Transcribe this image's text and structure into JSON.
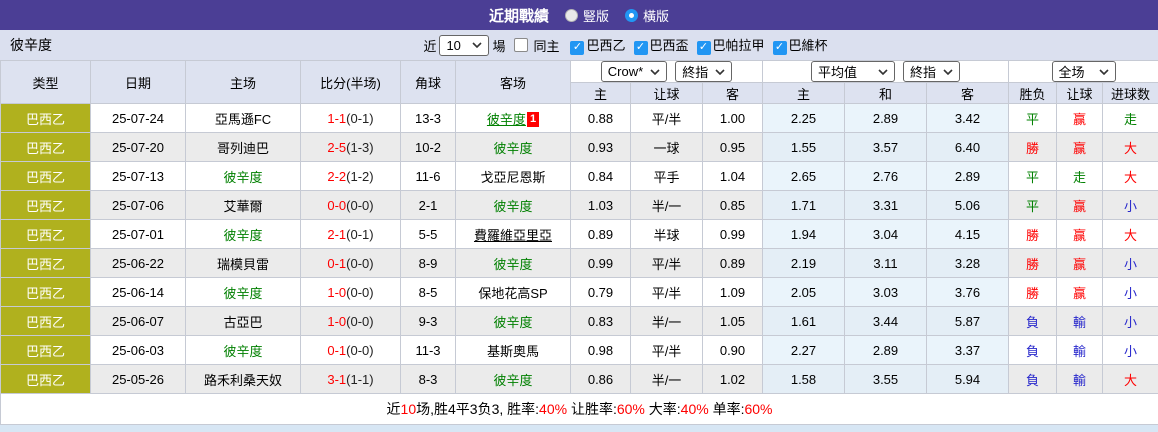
{
  "titlebar": {
    "title": "近期戰績",
    "radios": [
      {
        "label": "豎版",
        "checked": false
      },
      {
        "label": "橫版",
        "checked": true
      }
    ]
  },
  "filterbar": {
    "team": "彼辛度",
    "near_label": "近",
    "count_value": "10",
    "games_label": "場",
    "same_home": {
      "label": "同主",
      "checked": false
    },
    "leagues": [
      {
        "label": "巴西乙",
        "checked": true
      },
      {
        "label": "巴西盃",
        "checked": true
      },
      {
        "label": "巴帕拉甲",
        "checked": true
      },
      {
        "label": "巴維杯",
        "checked": true
      }
    ]
  },
  "colors": {
    "titlebar_purple": "#4b3e95",
    "league_cell_olive": "#b0b11e",
    "checkbox_blue": "#2196f3",
    "subject_green": "#008000",
    "win_red": "#ff0000",
    "loss_blue": "#2828cc",
    "avg_column_bg": "#eaf4fb",
    "header_bg": "#dde2f0",
    "filterbar_bg": "#dbe0ef"
  },
  "table": {
    "static_headers": [
      "类型",
      "日期",
      "主场",
      "比分(半场)",
      "角球",
      "客场"
    ],
    "group1": {
      "selects": [
        "Crow*",
        "終指"
      ],
      "cols": [
        "主",
        "让球",
        "客"
      ]
    },
    "group2": {
      "selects": [
        "平均值",
        "終指"
      ],
      "cols": [
        "主",
        "和",
        "客"
      ]
    },
    "group3": {
      "selects": [
        "全场"
      ],
      "cols": [
        "胜负",
        "让球",
        "进球数"
      ]
    },
    "rows": [
      {
        "league": "巴西乙",
        "date": "25-07-24",
        "home": {
          "name": "亞馬遜FC"
        },
        "score": "1-1",
        "half": "(0-1)",
        "corner": "13-3",
        "away": {
          "name": "彼辛度",
          "subject": true,
          "underline": true,
          "badge": "1"
        },
        "crow": [
          "0.88",
          "平/半",
          "1.00"
        ],
        "avg": [
          "2.25",
          "2.89",
          "3.42"
        ],
        "results": [
          {
            "text": "平",
            "color": "green"
          },
          {
            "text": "赢",
            "color": "red"
          },
          {
            "text": "走",
            "color": "green"
          }
        ]
      },
      {
        "league": "巴西乙",
        "date": "25-07-20",
        "home": {
          "name": "哥列迪巴"
        },
        "score": "2-5",
        "half": "(1-3)",
        "corner": "10-2",
        "away": {
          "name": "彼辛度",
          "subject": true
        },
        "crow": [
          "0.93",
          "一球",
          "0.95"
        ],
        "avg": [
          "1.55",
          "3.57",
          "6.40"
        ],
        "results": [
          {
            "text": "勝",
            "color": "red"
          },
          {
            "text": "赢",
            "color": "red"
          },
          {
            "text": "大",
            "color": "red"
          }
        ]
      },
      {
        "league": "巴西乙",
        "date": "25-07-13",
        "home": {
          "name": "彼辛度",
          "subject": true
        },
        "score": "2-2",
        "half": "(1-2)",
        "corner": "11-6",
        "away": {
          "name": "戈亞尼恩斯"
        },
        "crow": [
          "0.84",
          "平手",
          "1.04"
        ],
        "avg": [
          "2.65",
          "2.76",
          "2.89"
        ],
        "results": [
          {
            "text": "平",
            "color": "green"
          },
          {
            "text": "走",
            "color": "green"
          },
          {
            "text": "大",
            "color": "red"
          }
        ]
      },
      {
        "league": "巴西乙",
        "date": "25-07-06",
        "home": {
          "name": "艾華爾"
        },
        "score": "0-0",
        "half": "(0-0)",
        "corner": "2-1",
        "away": {
          "name": "彼辛度",
          "subject": true
        },
        "crow": [
          "1.03",
          "半/一",
          "0.85"
        ],
        "avg": [
          "1.71",
          "3.31",
          "5.06"
        ],
        "results": [
          {
            "text": "平",
            "color": "green"
          },
          {
            "text": "赢",
            "color": "red"
          },
          {
            "text": "小",
            "color": "blue"
          }
        ]
      },
      {
        "league": "巴西乙",
        "date": "25-07-01",
        "home": {
          "name": "彼辛度",
          "subject": true
        },
        "score": "2-1",
        "half": "(0-1)",
        "corner": "5-5",
        "away": {
          "name": "費羅維亞里亞",
          "underline": true
        },
        "crow": [
          "0.89",
          "半球",
          "0.99"
        ],
        "avg": [
          "1.94",
          "3.04",
          "4.15"
        ],
        "results": [
          {
            "text": "勝",
            "color": "red"
          },
          {
            "text": "赢",
            "color": "red"
          },
          {
            "text": "大",
            "color": "red"
          }
        ]
      },
      {
        "league": "巴西乙",
        "date": "25-06-22",
        "home": {
          "name": "瑞模貝雷"
        },
        "score": "0-1",
        "half": "(0-0)",
        "corner": "8-9",
        "away": {
          "name": "彼辛度",
          "subject": true
        },
        "crow": [
          "0.99",
          "平/半",
          "0.89"
        ],
        "avg": [
          "2.19",
          "3.11",
          "3.28"
        ],
        "results": [
          {
            "text": "勝",
            "color": "red"
          },
          {
            "text": "赢",
            "color": "red"
          },
          {
            "text": "小",
            "color": "blue"
          }
        ]
      },
      {
        "league": "巴西乙",
        "date": "25-06-14",
        "home": {
          "name": "彼辛度",
          "subject": true
        },
        "score": "1-0",
        "half": "(0-0)",
        "corner": "8-5",
        "away": {
          "name": "保地花高SP"
        },
        "crow": [
          "0.79",
          "平/半",
          "1.09"
        ],
        "avg": [
          "2.05",
          "3.03",
          "3.76"
        ],
        "results": [
          {
            "text": "勝",
            "color": "red"
          },
          {
            "text": "赢",
            "color": "red"
          },
          {
            "text": "小",
            "color": "blue"
          }
        ]
      },
      {
        "league": "巴西乙",
        "date": "25-06-07",
        "home": {
          "name": "古亞巴"
        },
        "score": "1-0",
        "half": "(0-0)",
        "corner": "9-3",
        "away": {
          "name": "彼辛度",
          "subject": true
        },
        "crow": [
          "0.83",
          "半/一",
          "1.05"
        ],
        "avg": [
          "1.61",
          "3.44",
          "5.87"
        ],
        "results": [
          {
            "text": "負",
            "color": "blue"
          },
          {
            "text": "輸",
            "color": "blue"
          },
          {
            "text": "小",
            "color": "blue"
          }
        ]
      },
      {
        "league": "巴西乙",
        "date": "25-06-03",
        "home": {
          "name": "彼辛度",
          "subject": true
        },
        "score": "0-1",
        "half": "(0-0)",
        "corner": "11-3",
        "away": {
          "name": "基斯奧馬"
        },
        "crow": [
          "0.98",
          "平/半",
          "0.90"
        ],
        "avg": [
          "2.27",
          "2.89",
          "3.37"
        ],
        "results": [
          {
            "text": "負",
            "color": "blue"
          },
          {
            "text": "輸",
            "color": "blue"
          },
          {
            "text": "小",
            "color": "blue"
          }
        ]
      },
      {
        "league": "巴西乙",
        "date": "25-05-26",
        "home": {
          "name": "路禾利桑天奴"
        },
        "score": "3-1",
        "half": "(1-1)",
        "corner": "8-3",
        "away": {
          "name": "彼辛度",
          "subject": true
        },
        "crow": [
          "0.86",
          "半/一",
          "1.02"
        ],
        "avg": [
          "1.58",
          "3.55",
          "5.94"
        ],
        "results": [
          {
            "text": "負",
            "color": "blue"
          },
          {
            "text": "輸",
            "color": "blue"
          },
          {
            "text": "大",
            "color": "red"
          }
        ]
      }
    ]
  },
  "summary": {
    "segments": [
      {
        "text": "近",
        "red": false
      },
      {
        "text": "10",
        "red": true
      },
      {
        "text": "场,胜4平3负3, 胜率:",
        "red": false
      },
      {
        "text": "40%",
        "red": true
      },
      {
        "text": " 让胜率:",
        "red": false
      },
      {
        "text": "60%",
        "red": true
      },
      {
        "text": " 大率:",
        "red": false
      },
      {
        "text": "40%",
        "red": true
      },
      {
        "text": " 单率:",
        "red": false
      },
      {
        "text": "60%",
        "red": true
      }
    ]
  }
}
